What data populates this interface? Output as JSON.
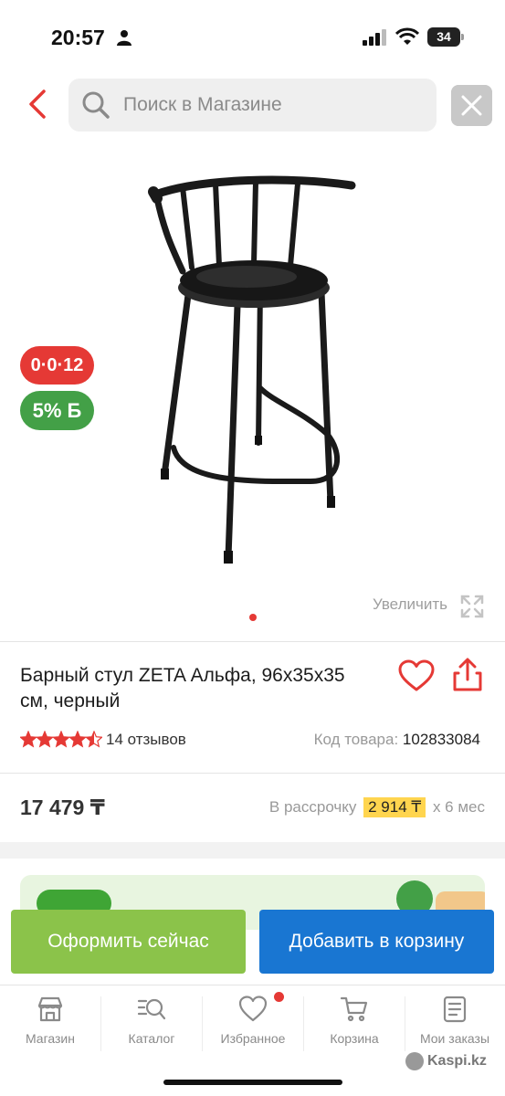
{
  "status_bar": {
    "time": "20:57",
    "battery": "34"
  },
  "search": {
    "placeholder": "Поиск в Магазине"
  },
  "product": {
    "badge_installment": "0·0·12",
    "badge_bonus": "5% Б",
    "zoom_label": "Увеличить",
    "title": "Барный стул ZETA Альфа, 96x35x35 см, черный",
    "rating": 4.5,
    "reviews_label": "14 отзывов",
    "sku_label": "Код товара:",
    "sku_value": "102833084",
    "price": "17 479 ₸",
    "installment_prefix": "В рассрочку",
    "installment_amount": "2 914 ₸",
    "installment_suffix": "x 6 мес",
    "image_count": 1,
    "active_image": 1
  },
  "actions": {
    "checkout_label": "Оформить сейчас",
    "add_to_cart_label": "Добавить в корзину"
  },
  "tab_bar": {
    "items": [
      {
        "label": "Магазин",
        "icon": "store-icon"
      },
      {
        "label": "Каталог",
        "icon": "catalog-search-icon"
      },
      {
        "label": "Избранное",
        "icon": "heart-icon"
      },
      {
        "label": "Корзина",
        "icon": "cart-icon"
      },
      {
        "label": "Мои заказы",
        "icon": "orders-icon"
      }
    ]
  },
  "watermark": "Kaspi.kz",
  "colors": {
    "accent_red": "#e53935",
    "green_button": "#8bc34a",
    "blue_button": "#1976d2",
    "bonus_green": "#43a047",
    "installment_highlight": "#ffd54f"
  }
}
